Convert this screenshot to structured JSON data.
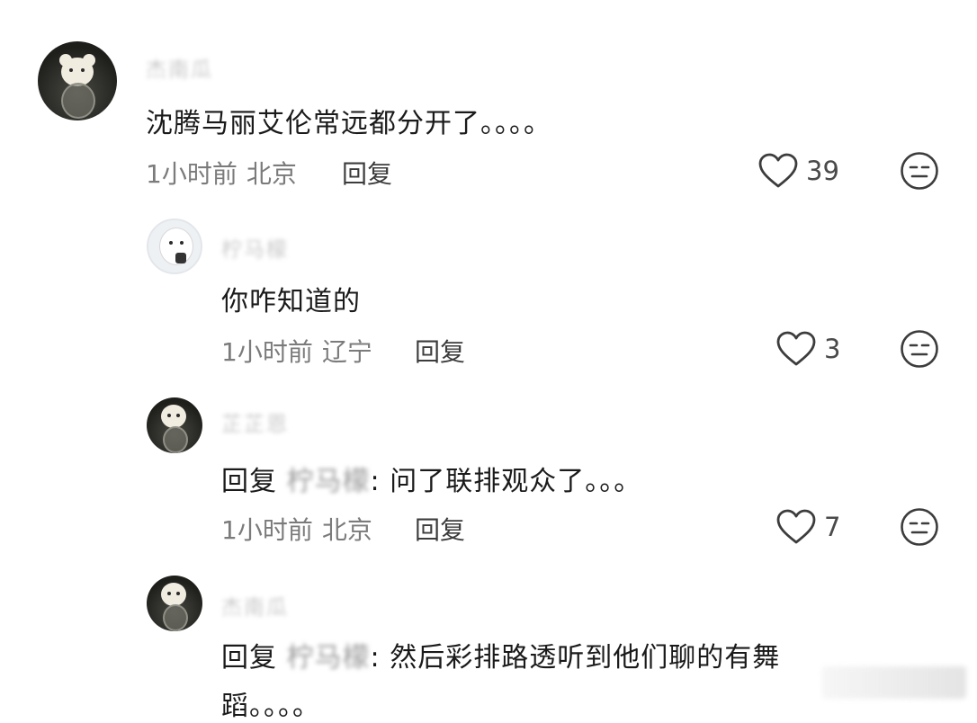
{
  "comments": [
    {
      "username": "杰南瓜",
      "text": "沈腾马丽艾伦常远都分开了。。。。",
      "time": "1小时前",
      "location": "北京",
      "reply_label": "回复",
      "likes": "39"
    },
    {
      "username": "柠马檬",
      "text": "你咋知道的",
      "time": "1小时前",
      "location": "辽宁",
      "reply_label": "回复",
      "likes": "3"
    },
    {
      "username": "芷芷恩",
      "reply_prefix": "回复",
      "reply_to": "柠马檬",
      "text": ": 问了联排观众了。。。",
      "time": "1小时前",
      "location": "北京",
      "reply_label": "回复",
      "likes": "7"
    },
    {
      "username": "杰南瓜",
      "reply_prefix": "回复",
      "reply_to": "柠马檬",
      "text": ": 然后彩排路透听到他们聊的有舞",
      "text_line2": "蹈。。。。"
    }
  ],
  "icons": {
    "like": "heart-outline-icon",
    "dislike": "neutral-face-icon"
  },
  "colors": {
    "meta_text": "#7b7b7b",
    "icon_stroke": "#3c3c3c"
  }
}
